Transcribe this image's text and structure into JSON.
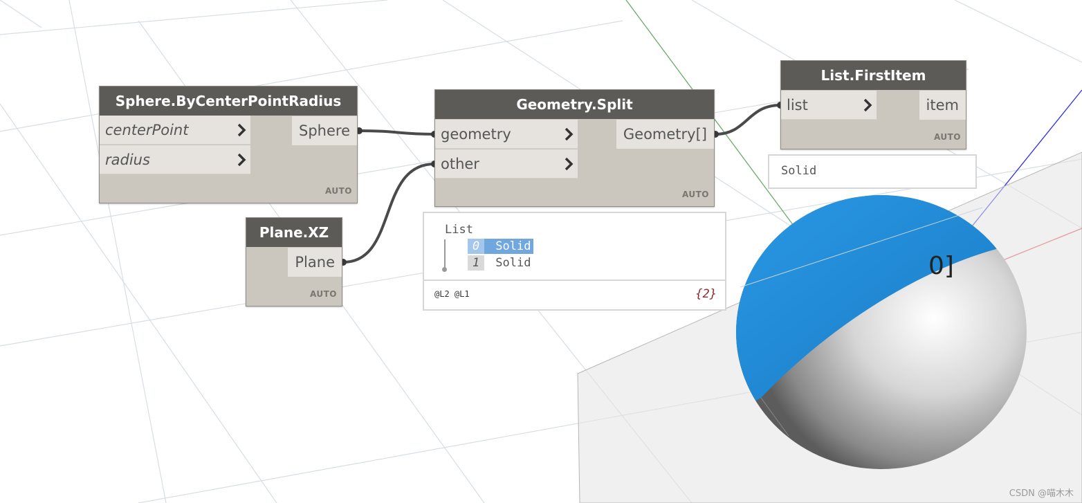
{
  "nodes": {
    "sphere": {
      "title": "Sphere.ByCenterPointRadius",
      "inputs": [
        "centerPoint",
        "radius"
      ],
      "output": "Sphere",
      "lacing": "AUTO"
    },
    "plane": {
      "title": "Plane.XZ",
      "output": "Plane",
      "lacing": "AUTO"
    },
    "split": {
      "title": "Geometry.Split",
      "inputs": [
        "geometry",
        "other"
      ],
      "output": "Geometry[]",
      "lacing": "AUTO"
    },
    "first": {
      "title": "List.FirstItem",
      "input": "list",
      "output": "item",
      "lacing": "AUTO"
    }
  },
  "split_preview": {
    "header": "List",
    "items": [
      {
        "index": "0",
        "value": "Solid",
        "selected": true
      },
      {
        "index": "1",
        "value": "Solid",
        "selected": false
      }
    ],
    "levels": "@L2 @L1",
    "count": "{2}"
  },
  "first_preview": {
    "value": "Solid"
  },
  "viewport_label": "0]",
  "watermark": "CSDN @喵木木",
  "colors": {
    "node_title": "#5d5b58",
    "node_body": "#cbc6be",
    "selection": "#6fa7de",
    "sphere_top": "#1a8ad9"
  }
}
